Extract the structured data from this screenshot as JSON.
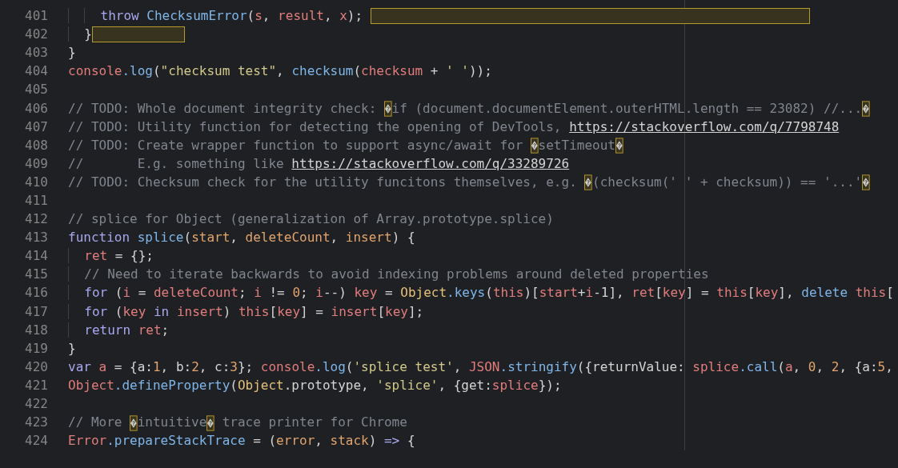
{
  "editor": {
    "lines": [
      {
        "number": "401",
        "trailing_whitespace": true,
        "tokens": [
          {
            "text": "    throw",
            "kind": "kw"
          },
          {
            "text": " ChecksumError",
            "kind": "fn"
          },
          {
            "text": "(",
            "kind": "plain"
          },
          {
            "text": "s",
            "kind": "var"
          },
          {
            "text": ",",
            "kind": "plain"
          },
          {
            "text": " result",
            "kind": "var"
          },
          {
            "text": ",",
            "kind": "plain"
          },
          {
            "text": " x",
            "kind": "var"
          },
          {
            "text": ");",
            "kind": "plain"
          }
        ]
      },
      {
        "number": "402",
        "trailing_whitespace": true,
        "tokens": [
          {
            "text": "  }",
            "kind": "plain"
          }
        ]
      },
      {
        "number": "403",
        "trailing_whitespace": false,
        "tokens": [
          {
            "text": "}",
            "kind": "plain"
          }
        ]
      },
      {
        "number": "404",
        "trailing_whitespace": false,
        "tokens": [
          {
            "text": "console",
            "kind": "var"
          },
          {
            "text": ".log",
            "kind": "fn"
          },
          {
            "text": "(",
            "kind": "plain"
          },
          {
            "text": "\"checksum test\"",
            "kind": "str"
          },
          {
            "text": ",",
            "kind": "plain"
          },
          {
            "text": " checksum",
            "kind": "fn"
          },
          {
            "text": "(",
            "kind": "plain"
          },
          {
            "text": "checksum",
            "kind": "var"
          },
          {
            "text": " +",
            "kind": "plain"
          },
          {
            "text": " ' '",
            "kind": "str"
          },
          {
            "text": "));",
            "kind": "plain"
          }
        ]
      },
      {
        "number": "405",
        "trailing_whitespace": false
      },
      {
        "number": "406",
        "trailing_whitespace": false,
        "tokens": [
          {
            "text": "// TODO: Whole document integrity check: ",
            "kind": "cm"
          },
          {
            "kind": "inv"
          },
          {
            "text": "if (document.documentElement.outerHTML.length == 23082) //...",
            "kind": "cm"
          },
          {
            "kind": "inv"
          }
        ]
      },
      {
        "number": "407",
        "trailing_whitespace": false,
        "tokens": [
          {
            "text": "// TODO: Utility function for detecting the opening of DevTools, ",
            "kind": "cm"
          },
          {
            "text": "https://stackoverflow.com/q/7798748",
            "kind": "link"
          }
        ]
      },
      {
        "number": "408",
        "trailing_whitespace": false,
        "tokens": [
          {
            "text": "// TODO: Create wrapper function to support async/await for ",
            "kind": "cm"
          },
          {
            "kind": "inv"
          },
          {
            "text": "setTimeout",
            "kind": "cm"
          },
          {
            "kind": "inv"
          }
        ]
      },
      {
        "number": "409",
        "trailing_whitespace": false,
        "tokens": [
          {
            "text": "//       E.g. something like ",
            "kind": "cm"
          },
          {
            "text": "https://stackoverflow.com/q/33289726",
            "kind": "link"
          }
        ]
      },
      {
        "number": "410",
        "trailing_whitespace": false,
        "tokens": [
          {
            "text": "// TODO: Checksum check for the utility funcitons themselves, e.g. ",
            "kind": "cm"
          },
          {
            "kind": "inv"
          },
          {
            "text": "(checksum(' ' + checksum)) == '...'",
            "kind": "cm"
          },
          {
            "kind": "inv"
          }
        ]
      },
      {
        "number": "411",
        "trailing_whitespace": false
      },
      {
        "number": "412",
        "trailing_whitespace": false,
        "tokens": [
          {
            "text": "// splice for Object (generalization of Array.prototype.splice)",
            "kind": "cm"
          }
        ]
      },
      {
        "number": "413",
        "trailing_whitespace": false,
        "tokens": [
          {
            "text": "function",
            "kind": "kw"
          },
          {
            "text": " splice",
            "kind": "fn"
          },
          {
            "text": "(",
            "kind": "plain"
          },
          {
            "text": "start",
            "kind": "param"
          },
          {
            "text": ",",
            "kind": "plain"
          },
          {
            "text": " deleteCount",
            "kind": "param"
          },
          {
            "text": ",",
            "kind": "plain"
          },
          {
            "text": " insert",
            "kind": "param"
          },
          {
            "text": ") {",
            "kind": "plain"
          }
        ]
      },
      {
        "number": "414",
        "trailing_whitespace": false,
        "tokens": [
          {
            "text": "  ret",
            "kind": "var"
          },
          {
            "text": " = {};",
            "kind": "plain"
          }
        ]
      },
      {
        "number": "415",
        "trailing_whitespace": false,
        "tokens": [
          {
            "text": "  // Need to iterate backwards to avoid indexing problems around deleted properties",
            "kind": "cm"
          }
        ]
      },
      {
        "number": "416",
        "trailing_whitespace": false,
        "tokens": [
          {
            "text": "  for",
            "kind": "kw"
          },
          {
            "text": " (",
            "kind": "plain"
          },
          {
            "text": "i",
            "kind": "var"
          },
          {
            "text": " =",
            "kind": "plain"
          },
          {
            "text": " deleteCount",
            "kind": "var"
          },
          {
            "text": ";",
            "kind": "plain"
          },
          {
            "text": " i",
            "kind": "var"
          },
          {
            "text": " !=",
            "kind": "plain"
          },
          {
            "text": " 0",
            "kind": "num"
          },
          {
            "text": ";",
            "kind": "plain"
          },
          {
            "text": " i",
            "kind": "var"
          },
          {
            "text": "--)",
            "kind": "plain"
          },
          {
            "text": " key",
            "kind": "var"
          },
          {
            "text": " =",
            "kind": "plain"
          },
          {
            "text": " Object",
            "kind": "type"
          },
          {
            "text": ".keys",
            "kind": "fn"
          },
          {
            "text": "(",
            "kind": "plain"
          },
          {
            "text": "this",
            "kind": "var"
          },
          {
            "text": ")[",
            "kind": "plain"
          },
          {
            "text": "start",
            "kind": "var"
          },
          {
            "text": "+",
            "kind": "plain"
          },
          {
            "text": "i",
            "kind": "var"
          },
          {
            "text": "-1],",
            "kind": "plain"
          },
          {
            "text": " ret",
            "kind": "var"
          },
          {
            "text": "[",
            "kind": "plain"
          },
          {
            "text": "key",
            "kind": "var"
          },
          {
            "text": "] =",
            "kind": "plain"
          },
          {
            "text": " this",
            "kind": "var"
          },
          {
            "text": "[",
            "kind": "plain"
          },
          {
            "text": "key",
            "kind": "var"
          },
          {
            "text": "],",
            "kind": "plain"
          },
          {
            "text": " delete",
            "kind": "fn"
          },
          {
            "text": " this",
            "kind": "var"
          },
          {
            "text": "[",
            "kind": "plain"
          }
        ]
      },
      {
        "number": "417",
        "trailing_whitespace": false,
        "tokens": [
          {
            "text": "  for",
            "kind": "kw"
          },
          {
            "text": " (",
            "kind": "plain"
          },
          {
            "text": "key",
            "kind": "var"
          },
          {
            "text": " in",
            "kind": "kw"
          },
          {
            "text": " insert",
            "kind": "var"
          },
          {
            "text": ")",
            "kind": "plain"
          },
          {
            "text": " this",
            "kind": "var"
          },
          {
            "text": "[",
            "kind": "plain"
          },
          {
            "text": "key",
            "kind": "var"
          },
          {
            "text": "] =",
            "kind": "plain"
          },
          {
            "text": " insert",
            "kind": "var"
          },
          {
            "text": "[",
            "kind": "plain"
          },
          {
            "text": "key",
            "kind": "var"
          },
          {
            "text": "];",
            "kind": "plain"
          }
        ]
      },
      {
        "number": "418",
        "trailing_whitespace": false,
        "tokens": [
          {
            "text": "  return",
            "kind": "kw"
          },
          {
            "text": " ret",
            "kind": "var"
          },
          {
            "text": ";",
            "kind": "plain"
          }
        ]
      },
      {
        "number": "419",
        "trailing_whitespace": false,
        "tokens": [
          {
            "text": "}",
            "kind": "plain"
          }
        ]
      },
      {
        "number": "420",
        "trailing_whitespace": false,
        "tokens": [
          {
            "text": "var",
            "kind": "kw"
          },
          {
            "text": " a",
            "kind": "var"
          },
          {
            "text": " = {a:",
            "kind": "plain"
          },
          {
            "text": "1",
            "kind": "num"
          },
          {
            "text": ", b:",
            "kind": "plain"
          },
          {
            "text": "2",
            "kind": "num"
          },
          {
            "text": ", c:",
            "kind": "plain"
          },
          {
            "text": "3",
            "kind": "num"
          },
          {
            "text": "};",
            "kind": "plain"
          },
          {
            "text": " console",
            "kind": "var"
          },
          {
            "text": ".log",
            "kind": "fn"
          },
          {
            "text": "(",
            "kind": "plain"
          },
          {
            "text": "'splice test'",
            "kind": "str"
          },
          {
            "text": ",",
            "kind": "plain"
          },
          {
            "text": " JSON",
            "kind": "var"
          },
          {
            "text": ".stringify",
            "kind": "fn"
          },
          {
            "text": "({returnValue:",
            "kind": "plain"
          },
          {
            "text": " splice",
            "kind": "var"
          },
          {
            "text": ".call",
            "kind": "fn"
          },
          {
            "text": "(",
            "kind": "plain"
          },
          {
            "text": "a",
            "kind": "var"
          },
          {
            "text": ",",
            "kind": "plain"
          },
          {
            "text": " 0",
            "kind": "num"
          },
          {
            "text": ",",
            "kind": "plain"
          },
          {
            "text": " 2",
            "kind": "num"
          },
          {
            "text": ", {a:",
            "kind": "plain"
          },
          {
            "text": "5",
            "kind": "num"
          },
          {
            "text": ",",
            "kind": "plain"
          }
        ]
      },
      {
        "number": "421",
        "trailing_whitespace": false,
        "tokens": [
          {
            "text": "Object",
            "kind": "var"
          },
          {
            "text": ".defineProperty",
            "kind": "fn"
          },
          {
            "text": "(",
            "kind": "plain"
          },
          {
            "text": "Object",
            "kind": "type"
          },
          {
            "text": ".prototype,",
            "kind": "plain"
          },
          {
            "text": " 'splice'",
            "kind": "str"
          },
          {
            "text": ", {get:",
            "kind": "plain"
          },
          {
            "text": "splice",
            "kind": "var"
          },
          {
            "text": "});",
            "kind": "plain"
          }
        ]
      },
      {
        "number": "422",
        "trailing_whitespace": false
      },
      {
        "number": "423",
        "trailing_whitespace": false,
        "tokens": [
          {
            "text": "// More ",
            "kind": "cm"
          },
          {
            "kind": "inv"
          },
          {
            "text": "intuitive",
            "kind": "cm"
          },
          {
            "kind": "inv"
          },
          {
            "text": " trace printer for Chrome",
            "kind": "cm"
          }
        ]
      },
      {
        "number": "424",
        "trailing_whitespace": false,
        "tokens": [
          {
            "text": "Error",
            "kind": "var"
          },
          {
            "text": ".prepareStackTrace",
            "kind": "fn"
          },
          {
            "text": " = (",
            "kind": "plain"
          },
          {
            "text": "error",
            "kind": "param"
          },
          {
            "text": ",",
            "kind": "plain"
          },
          {
            "text": " stack",
            "kind": "param"
          },
          {
            "text": ")",
            "kind": "plain"
          },
          {
            "text": " =>",
            "kind": "kw"
          },
          {
            "text": " {",
            "kind": "plain"
          }
        ]
      }
    ]
  }
}
